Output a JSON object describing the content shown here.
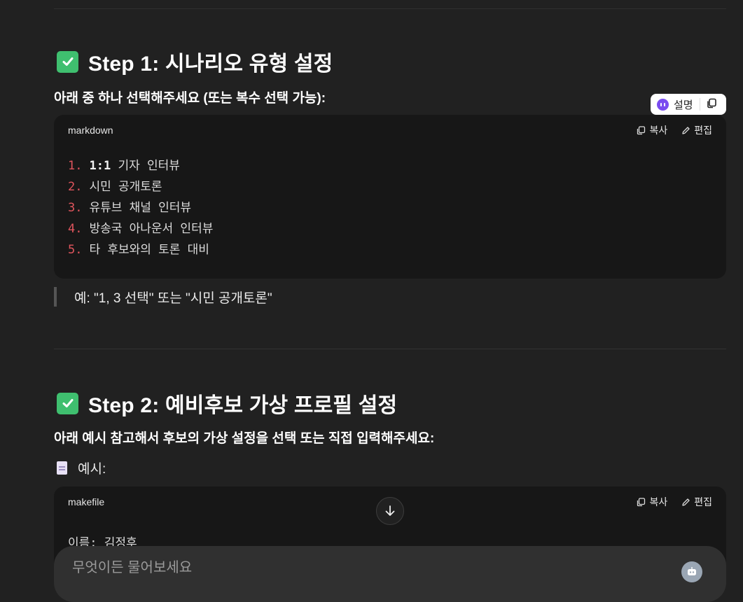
{
  "step1": {
    "title": "Step 1: 시나리오 유형 설정",
    "subtitle": "아래 중 하나 선택해주세요 (또는 복수 선택 가능):",
    "code": {
      "lang": "markdown",
      "copy_label": "복사",
      "edit_label": "편집",
      "lines": [
        {
          "num": "1.",
          "bold": "1:1",
          "text": " 기자 인터뷰"
        },
        {
          "num": "2.",
          "bold": "",
          "text": "시민 공개토론"
        },
        {
          "num": "3.",
          "bold": "",
          "text": "유튜브 채널 인터뷰"
        },
        {
          "num": "4.",
          "bold": "",
          "text": "방송국 아나운서 인터뷰"
        },
        {
          "num": "5.",
          "bold": "",
          "text": "타 후보와의 토론 대비"
        }
      ]
    },
    "quote": "예: \"1, 3 선택\" 또는 \"시민 공개토론\""
  },
  "explain_pill": {
    "label": "설명"
  },
  "step2": {
    "title": "Step 2: 예비후보 가상 프로필 설정",
    "subtitle": "아래 예시 참고해서 후보의 가상 설정을 선택 또는 직접 입력해주세요:",
    "example_label": "예시:",
    "code": {
      "lang": "makefile",
      "copy_label": "복사",
      "edit_label": "편집",
      "first_line": "이름: 김정후"
    }
  },
  "composer": {
    "placeholder": "무엇이든 물어보세요"
  },
  "colors": {
    "background": "#212121",
    "code_bg": "#171717",
    "check": "#3fbf6f",
    "line_number": "#e0555d"
  }
}
